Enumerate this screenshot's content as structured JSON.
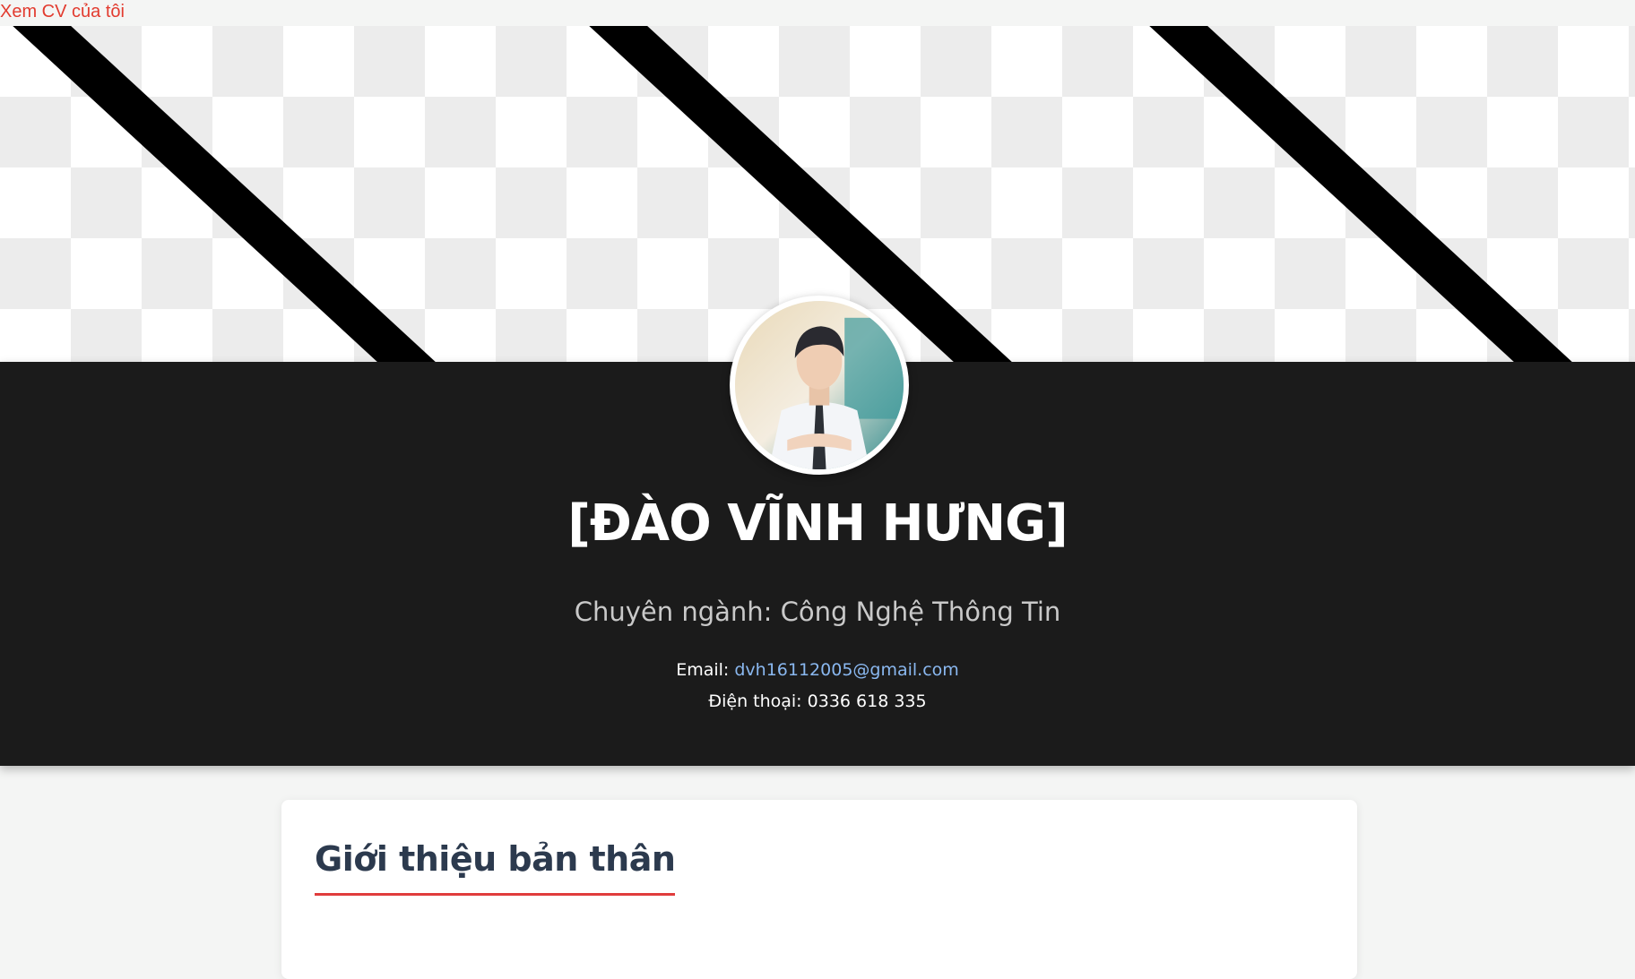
{
  "top_link": {
    "label": "Xem CV của tôi"
  },
  "hero": {
    "name": "[ĐÀO VĨNH HƯNG]",
    "major": "Chuyên ngành: Công Nghệ Thông Tin",
    "email_label": "Email:",
    "email_value": "dvh16112005@gmail.com",
    "phone_label": "Điện thoại:",
    "phone_value": "0336 618 335"
  },
  "about": {
    "title": "Giới thiệu bản thân"
  },
  "colors": {
    "accent_red": "#e03c3c",
    "hero_background": "#1b1b1b",
    "link_blue": "#8ab8f0",
    "title_navy": "#2c3a4e"
  }
}
